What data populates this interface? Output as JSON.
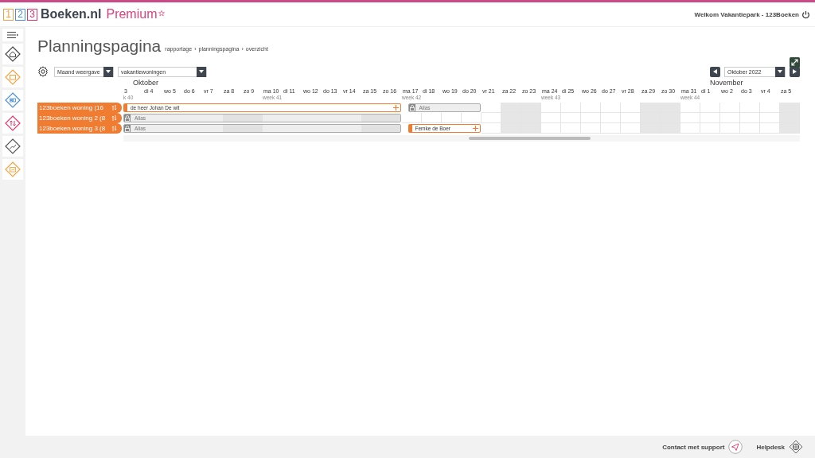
{
  "header": {
    "logo_digits": [
      "1",
      "2",
      "3"
    ],
    "logo_name": "Boeken.nl",
    "logo_tier": "Premium",
    "welcome": "Welkom Vakantiepark - 123Boeken"
  },
  "sidebar": {
    "items": [
      {
        "kind": "home"
      },
      {
        "kind": "calendar",
        "color": "#f5a03c"
      },
      {
        "kind": "grid",
        "color": "#4a8fd8"
      },
      {
        "kind": "sort",
        "color": "#e0356b"
      },
      {
        "kind": "chart",
        "color": "#555555"
      },
      {
        "kind": "report",
        "color": "#f5a03c"
      }
    ]
  },
  "page": {
    "title": "Planningspagina",
    "breadcrumb": [
      {
        "label": "rapportage"
      },
      {
        "separator": "›",
        "label": "planningspagina"
      },
      {
        "separator": "›",
        "label": "overzicht"
      }
    ]
  },
  "toolbar": {
    "view": "Maand weergave",
    "category": "vakantiewoningen",
    "period": "Oktober 2022"
  },
  "planner": {
    "days": [
      {
        "label": "3",
        "week": "k 40",
        "month": "Oktober",
        "weekend": false
      },
      {
        "label": "di 4",
        "weekend": false
      },
      {
        "label": "wo 5",
        "weekend": false
      },
      {
        "label": "do 6",
        "weekend": false
      },
      {
        "label": "vr 7",
        "weekend": false
      },
      {
        "label": "za 8",
        "weekend": true
      },
      {
        "label": "zo 9",
        "weekend": true
      },
      {
        "label": "ma 10",
        "week": "week 41",
        "weekend": false
      },
      {
        "label": "di 11",
        "weekend": false
      },
      {
        "label": "wo 12",
        "weekend": false
      },
      {
        "label": "do 13",
        "weekend": false
      },
      {
        "label": "vr 14",
        "weekend": false
      },
      {
        "label": "za 15",
        "weekend": true
      },
      {
        "label": "zo 16",
        "weekend": true
      },
      {
        "label": "ma 17",
        "week": "week 42",
        "weekend": false
      },
      {
        "label": "di 18",
        "weekend": false
      },
      {
        "label": "wo 19",
        "weekend": false
      },
      {
        "label": "do 20",
        "weekend": false
      },
      {
        "label": "vr 21",
        "weekend": false
      },
      {
        "label": "za 22",
        "weekend": true
      },
      {
        "label": "zo 23",
        "weekend": true
      },
      {
        "label": "ma 24",
        "week": "week 43",
        "weekend": false
      },
      {
        "label": "di 25",
        "weekend": false
      },
      {
        "label": "wo 26",
        "weekend": false
      },
      {
        "label": "do 27",
        "weekend": false
      },
      {
        "label": "vr 28",
        "weekend": false
      },
      {
        "label": "za 29",
        "weekend": true
      },
      {
        "label": "zo 30",
        "weekend": true
      },
      {
        "label": "ma 31",
        "week": "week 44",
        "weekend": false
      },
      {
        "label": "di 1",
        "month": "November",
        "weekend": false
      },
      {
        "label": "wo 2",
        "weekend": false
      },
      {
        "label": "do 3",
        "weekend": false
      },
      {
        "label": "vr 4",
        "weekend": false
      },
      {
        "label": "za 5",
        "weekend": true
      }
    ],
    "rows": [
      {
        "name": "123boeken woning (16",
        "cells": [
          {
            "kind": "guest",
            "label": "de heer Johan De wit"
          },
          {
            "kind": "guest"
          },
          {
            "kind": "guest"
          },
          {
            "kind": "guest"
          },
          {
            "kind": "guest"
          },
          {
            "kind": "guest"
          },
          {
            "kind": "guest"
          },
          {
            "kind": "guest"
          },
          {
            "kind": "guest"
          },
          {
            "kind": "guest"
          },
          {
            "kind": "guest"
          },
          {
            "kind": "guest"
          },
          {
            "kind": "guest"
          },
          {
            "kind": "guest"
          },
          {
            "kind": "blocked",
            "label": "Alias"
          },
          {
            "kind": "blocked"
          },
          {
            "kind": "blocked"
          },
          {
            "kind": "blocked"
          },
          {
            "kind": "free"
          },
          {
            "kind": "free"
          },
          {
            "kind": "free"
          },
          {
            "kind": "free"
          },
          {
            "kind": "free"
          },
          {
            "kind": "free"
          },
          {
            "kind": "free"
          },
          {
            "kind": "free"
          },
          {
            "kind": "free"
          },
          {
            "kind": "free"
          },
          {
            "kind": "free"
          },
          {
            "kind": "free"
          },
          {
            "kind": "free"
          },
          {
            "kind": "free"
          },
          {
            "kind": "free"
          },
          {
            "kind": "free"
          }
        ]
      },
      {
        "name": "123boeken woning 2 (8",
        "cells": [
          {
            "kind": "blocked",
            "label": "Alias"
          },
          {
            "kind": "blocked"
          },
          {
            "kind": "blocked"
          },
          {
            "kind": "blocked"
          },
          {
            "kind": "blocked"
          },
          {
            "kind": "blocked"
          },
          {
            "kind": "blocked"
          },
          {
            "kind": "blocked"
          },
          {
            "kind": "blocked"
          },
          {
            "kind": "blocked"
          },
          {
            "kind": "blocked"
          },
          {
            "kind": "blocked"
          },
          {
            "kind": "blocked"
          },
          {
            "kind": "blocked"
          },
          {
            "kind": "free"
          },
          {
            "kind": "free"
          },
          {
            "kind": "free"
          },
          {
            "kind": "free"
          },
          {
            "kind": "free"
          },
          {
            "kind": "free"
          },
          {
            "kind": "free"
          },
          {
            "kind": "free"
          },
          {
            "kind": "free"
          },
          {
            "kind": "free"
          },
          {
            "kind": "free"
          },
          {
            "kind": "free"
          },
          {
            "kind": "free"
          },
          {
            "kind": "free"
          },
          {
            "kind": "free"
          },
          {
            "kind": "free"
          },
          {
            "kind": "free"
          },
          {
            "kind": "free"
          },
          {
            "kind": "free"
          },
          {
            "kind": "free"
          }
        ]
      },
      {
        "name": "123boeken woning 3 (8",
        "cells": [
          {
            "kind": "blocked",
            "label": "Alias"
          },
          {
            "kind": "blocked"
          },
          {
            "kind": "blocked"
          },
          {
            "kind": "blocked"
          },
          {
            "kind": "blocked"
          },
          {
            "kind": "blocked"
          },
          {
            "kind": "blocked"
          },
          {
            "kind": "blocked"
          },
          {
            "kind": "blocked"
          },
          {
            "kind": "blocked"
          },
          {
            "kind": "blocked"
          },
          {
            "kind": "blocked"
          },
          {
            "kind": "blocked"
          },
          {
            "kind": "blocked"
          },
          {
            "kind": "guest",
            "label": "Femke de Boer"
          },
          {
            "kind": "guest"
          },
          {
            "kind": "guest"
          },
          {
            "kind": "guest"
          },
          {
            "kind": "free"
          },
          {
            "kind": "free"
          },
          {
            "kind": "free"
          },
          {
            "kind": "free"
          },
          {
            "kind": "free"
          },
          {
            "kind": "free"
          },
          {
            "kind": "free"
          },
          {
            "kind": "free"
          },
          {
            "kind": "free"
          },
          {
            "kind": "free"
          },
          {
            "kind": "free"
          },
          {
            "kind": "free"
          },
          {
            "kind": "free"
          },
          {
            "kind": "free"
          },
          {
            "kind": "free"
          },
          {
            "kind": "free"
          }
        ]
      }
    ]
  },
  "footer": {
    "support": "Contact met support",
    "helpdesk": "Helpdesk"
  }
}
